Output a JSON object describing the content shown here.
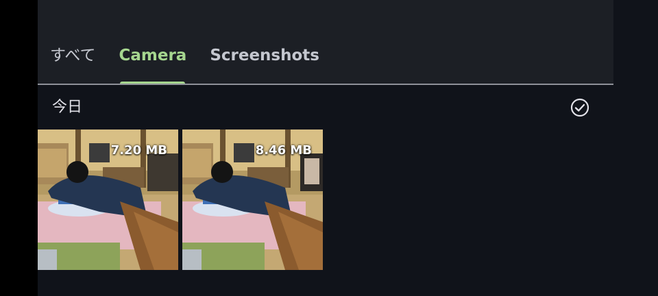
{
  "tabs": [
    {
      "label": "すべて",
      "selected": false
    },
    {
      "label": "Camera",
      "selected": true
    },
    {
      "label": "Screenshots",
      "selected": false
    }
  ],
  "section": {
    "title": "今日",
    "select_icon": "check-circle-icon"
  },
  "photos": [
    {
      "size": "7.20 MB"
    },
    {
      "size": "8.46 MB"
    }
  ],
  "colors": {
    "accent": "#a6d68f",
    "header_bg": "#1c1f25",
    "page_bg": "#10131a"
  }
}
